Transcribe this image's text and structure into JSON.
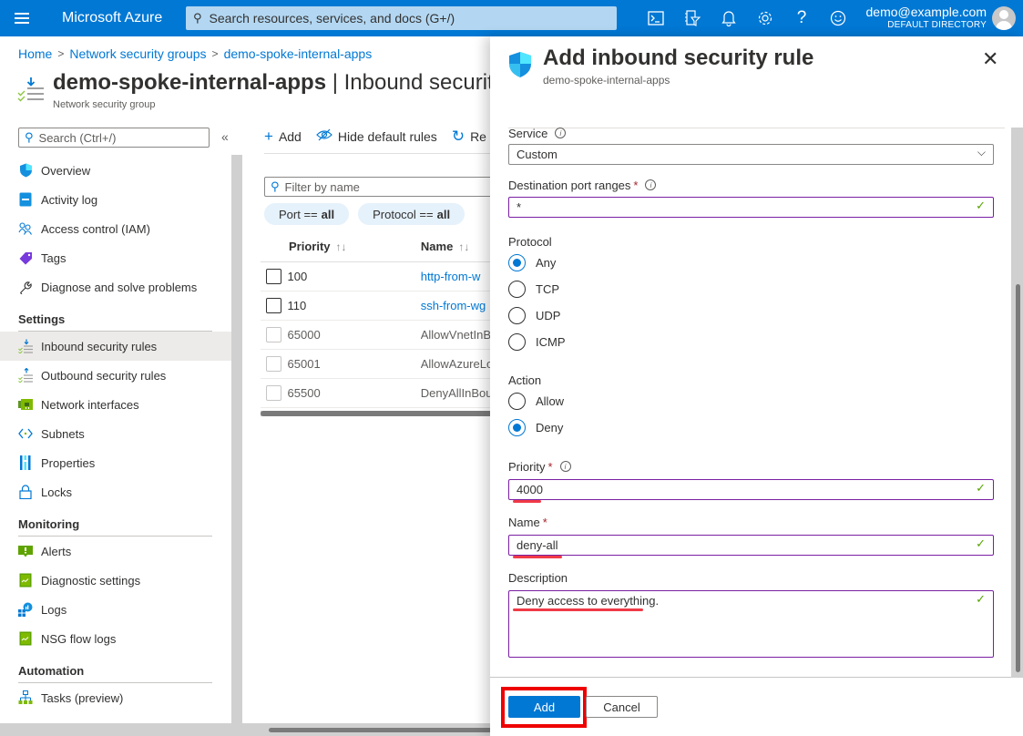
{
  "topbar": {
    "brand": "Microsoft Azure",
    "search_placeholder": "Search resources, services, and docs (G+/)",
    "icons": [
      "cloud-shell-icon",
      "directory-filter-icon",
      "notifications-icon",
      "settings-icon",
      "help-icon",
      "feedback-icon"
    ],
    "account_email": "demo@example.com",
    "account_directory": "DEFAULT DIRECTORY"
  },
  "breadcrumb": [
    "Home",
    "Network security groups",
    "demo-spoke-internal-apps"
  ],
  "page": {
    "title_resource": "demo-spoke-internal-apps",
    "title_section": " | Inbound security rules",
    "subtitle": "Network security group"
  },
  "sidebar": {
    "search_placeholder": "Search (Ctrl+/)",
    "collapse_glyph": "«",
    "items_top": [
      {
        "label": "Overview",
        "icon": "shield-icon"
      },
      {
        "label": "Activity log",
        "icon": "activity-log-icon"
      },
      {
        "label": "Access control (IAM)",
        "icon": "people-icon"
      },
      {
        "label": "Tags",
        "icon": "tag-icon"
      },
      {
        "label": "Diagnose and solve problems",
        "icon": "wrench-icon"
      }
    ],
    "settings_header": "Settings",
    "items_settings": [
      {
        "label": "Inbound security rules",
        "icon": "inbound-rules-icon",
        "active": true
      },
      {
        "label": "Outbound security rules",
        "icon": "outbound-rules-icon"
      },
      {
        "label": "Network interfaces",
        "icon": "network-interface-icon"
      },
      {
        "label": "Subnets",
        "icon": "subnet-icon"
      },
      {
        "label": "Properties",
        "icon": "properties-icon"
      },
      {
        "label": "Locks",
        "icon": "lock-icon"
      }
    ],
    "monitoring_header": "Monitoring",
    "items_monitoring": [
      {
        "label": "Alerts",
        "icon": "alert-icon"
      },
      {
        "label": "Diagnostic settings",
        "icon": "diagnostic-icon"
      },
      {
        "label": "Logs",
        "icon": "logs-icon"
      },
      {
        "label": "NSG flow logs",
        "icon": "flow-logs-icon"
      }
    ],
    "automation_header": "Automation",
    "items_automation": [
      {
        "label": "Tasks (preview)",
        "icon": "tasks-icon"
      }
    ]
  },
  "toolbar": {
    "add": "Add",
    "hide_default": "Hide default rules",
    "refresh": "Re"
  },
  "filter": {
    "placeholder": "Filter by name",
    "pills": [
      {
        "key": "Port ==",
        "value": "all"
      },
      {
        "key": "Protocol ==",
        "value": "all"
      }
    ]
  },
  "grid": {
    "headers": {
      "priority": "Priority",
      "name": "Name",
      "sort_glyph": "↑↓"
    },
    "rows": [
      {
        "priority": "100",
        "name": "http-from-w",
        "link": true
      },
      {
        "priority": "110",
        "name": "ssh-from-wg",
        "link": true
      },
      {
        "priority": "65000",
        "name": "AllowVnetInBound",
        "link": false
      },
      {
        "priority": "65001",
        "name": "AllowAzureLoadBalancerInBound",
        "link": false
      },
      {
        "priority": "65500",
        "name": "DenyAllInBound",
        "link": false
      }
    ]
  },
  "blade": {
    "title": "Add inbound security rule",
    "subtitle": "demo-spoke-internal-apps",
    "close_glyph": "✕",
    "service": {
      "label": "Service",
      "value": "Custom"
    },
    "dest_ports": {
      "label": "Destination port ranges",
      "value": "*"
    },
    "protocol": {
      "label": "Protocol",
      "options": [
        "Any",
        "TCP",
        "UDP",
        "ICMP"
      ],
      "selected": "Any"
    },
    "action": {
      "label": "Action",
      "options": [
        "Allow",
        "Deny"
      ],
      "selected": "Deny"
    },
    "priority": {
      "label": "Priority",
      "value": "4000"
    },
    "name": {
      "label": "Name",
      "value": "deny-all"
    },
    "description": {
      "label": "Description",
      "value": "Deny access to everything."
    },
    "add_button": "Add",
    "cancel_button": "Cancel"
  },
  "colors": {
    "accent": "#0078d4",
    "valid_border": "#7a1fa2",
    "valid_check": "#57a300",
    "highlight": "#ee0000",
    "underline": "#f03a47"
  }
}
